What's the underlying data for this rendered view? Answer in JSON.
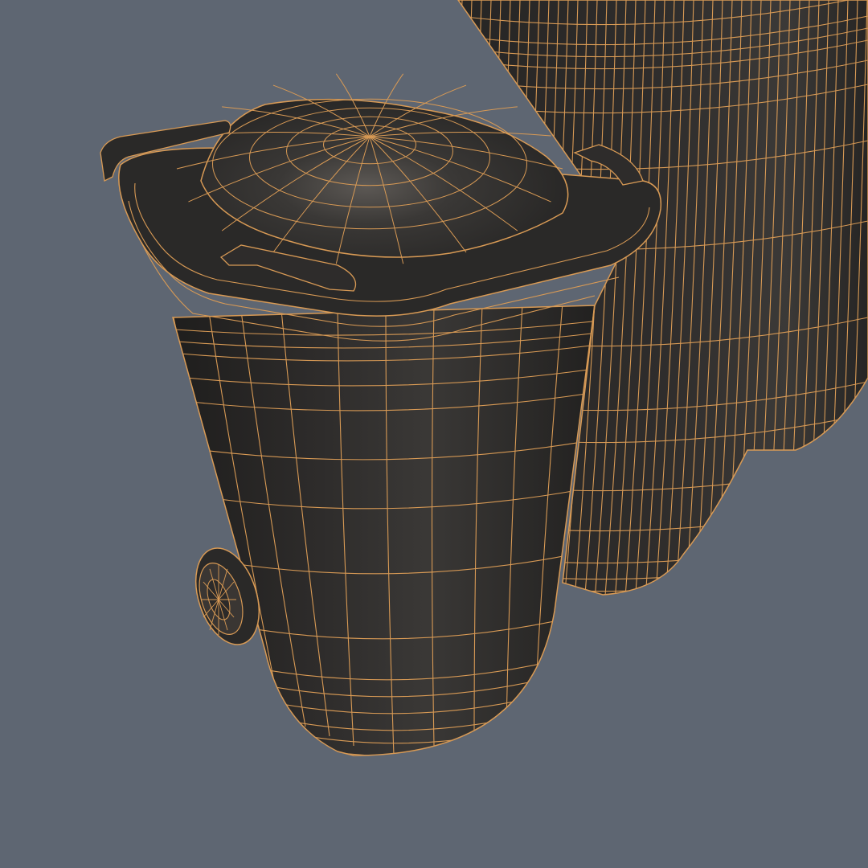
{
  "scene": {
    "background_color": "#5e6672",
    "mesh_color": "#2c2b2a",
    "mesh_shadow_color": "#1c1b1b",
    "highlight_color": "#6a6661",
    "wireframe_color": "#d89a55",
    "objects": [
      "wheelie-bin-front",
      "wheelie-bin-back"
    ]
  }
}
